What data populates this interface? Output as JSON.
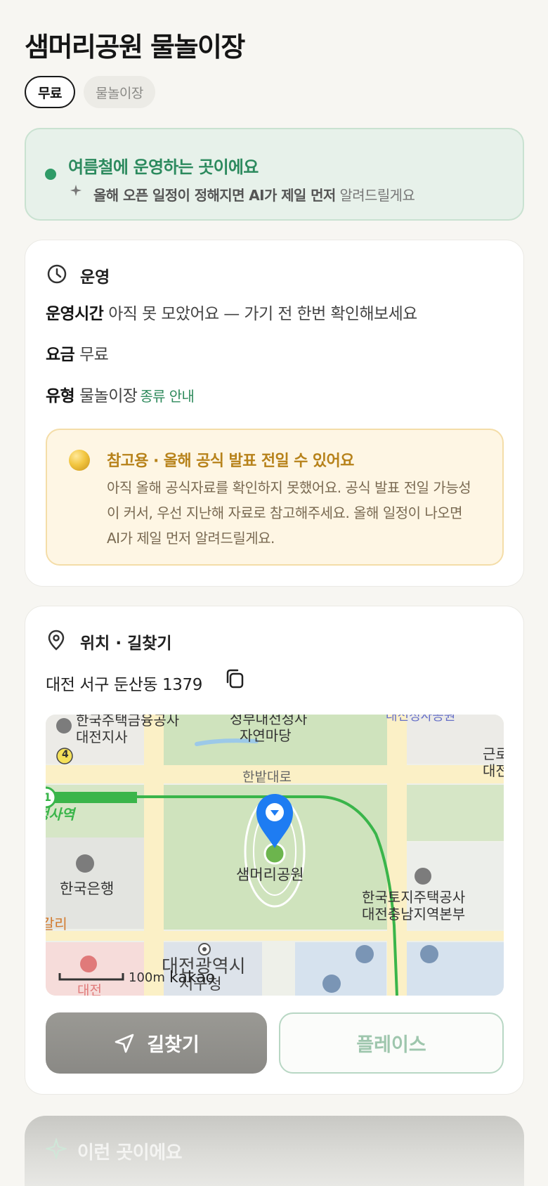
{
  "title": "샘머리공원 물놀이장",
  "chips": [
    "무료",
    "물놀이장"
  ],
  "season_notice": {
    "title": "여름철에 운영하는 곳이에요",
    "subtitle_bold": "올해 오픈 일정이 정해지면 AI가 제일 먼저",
    "subtitle_rest": " 알려드릴게요"
  },
  "operations": {
    "heading": "운영",
    "hours_key": "운영시간",
    "hours_value": "아직 못 모았어요 — 가기 전 한번 확인해보세요",
    "fee_key": "요금",
    "fee_value": "무료",
    "type_key": "유형",
    "type_value": "물놀이장",
    "type_link": "종류 안내",
    "note_title": "참고용 · 올해 공식 발표 전일 수 있어요",
    "note_body": "아직 올해 공식자료를 확인하지 못했어요. 공식 발표 전일 가능성이 커서, 우선 지난해 자료로 참고해주세요. 올해 일정이 나오면 AI가 제일 먼저 알려드릴게요."
  },
  "location": {
    "heading": "위치 · 길찾기",
    "address": "대전 서구 둔산동 1379",
    "map": {
      "labels": {
        "building1": "한국주택금융공사",
        "building1b": "대전지사",
        "garden": "정부대전청사",
        "garden_b": "자연마당",
        "road": "한밭대로",
        "park": "샘머리공원",
        "bank": "한국은행",
        "lh": "한국토지주택공사",
        "lh_b": "대전충남지역본부",
        "cityhall": "대전광역시",
        "cityhall_b": "서구청",
        "station": "청사역",
        "hospital": "대전",
        "left_cut": "갈리",
        "right_cut1": "근로",
        "right_cut2": "대전",
        "top_right": "대전청사공원",
        "line_badge": "4",
        "line_badge_1": "1",
        "scale": "100m",
        "brand": "kakao"
      }
    },
    "route_button": "길찾기",
    "place_button": "플레이스"
  },
  "more": {
    "title": "이런 곳이에요"
  },
  "colors": {
    "accent_green": "#2f9b67",
    "amber": "#b7821a",
    "pin_blue": "#1e7cf2"
  }
}
